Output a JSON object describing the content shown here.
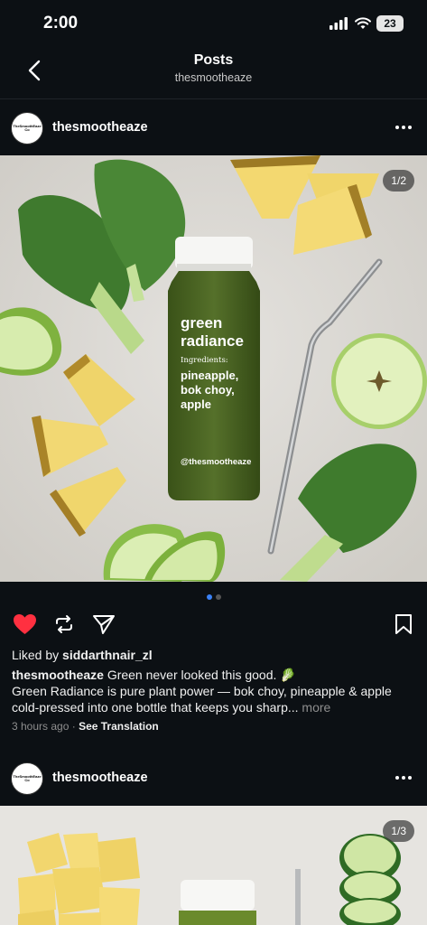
{
  "status": {
    "time": "2:00",
    "battery": "23"
  },
  "nav": {
    "title": "Posts",
    "subtitle": "thesmootheaze"
  },
  "avatar_text": "TheSmoothEaze Co",
  "posts": [
    {
      "username": "thesmootheaze",
      "counter": "1/2",
      "bottle_brand": "green radiance",
      "bottle_ingredients_label": "Ingredients:",
      "bottle_ingredients": "pineapple, bok choy, apple",
      "bottle_handle": "@thesmootheaze",
      "liked_prefix": "Liked by ",
      "liked_by": "siddarthnair_zl",
      "caption_user": "thesmootheaze",
      "caption_line1": "Green never looked this good. 🥬",
      "caption_line2": "Green Radiance is pure plant power — bok choy, pineapple & apple",
      "caption_line3": "cold-pressed into one bottle that keeps you sharp...",
      "more": " more",
      "time_ago": "3 hours ago",
      "see_translation": "See Translation",
      "liked": true
    },
    {
      "username": "thesmootheaze",
      "counter": "1/3"
    }
  ],
  "colors": {
    "background": "#0c1014",
    "like_red": "#ff3040",
    "dot_active": "#3b82f6"
  }
}
